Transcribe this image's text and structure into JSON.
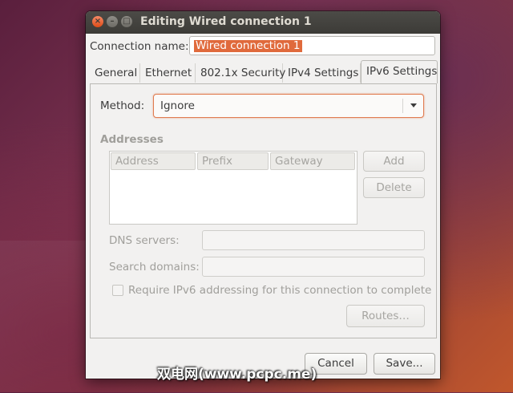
{
  "window": {
    "title": "Editing Wired connection 1"
  },
  "connection": {
    "label": "Connection name:",
    "value": "Wired connection 1"
  },
  "tabs": [
    "General",
    "Ethernet",
    "802.1x Security",
    "IPv4 Settings",
    "IPv6 Settings"
  ],
  "method": {
    "label": "Method:",
    "value": "Ignore"
  },
  "addresses": {
    "heading": "Addresses",
    "columns": [
      "Address",
      "Prefix",
      "Gateway"
    ],
    "add_label": "Add",
    "delete_label": "Delete"
  },
  "dns": {
    "label": "DNS servers:"
  },
  "search_domains": {
    "label": "Search domains:"
  },
  "require": {
    "label": "Require IPv6 addressing for this connection to complete"
  },
  "routes_label": "Routes…",
  "footer": {
    "cancel_label": "Cancel",
    "save_label": "Save..."
  },
  "watermark": "双电网(www.pcpc.me)",
  "colors": {
    "accent": "#e06a3c",
    "titlebar": "#3c3b37",
    "window_bg": "#f2f1f0"
  }
}
